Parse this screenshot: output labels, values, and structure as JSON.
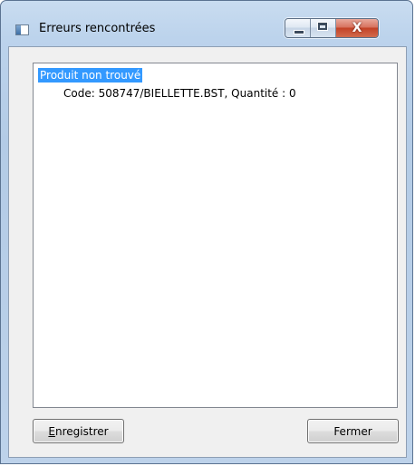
{
  "window": {
    "title": "Erreurs rencontrées",
    "icon": "app-window-icon",
    "caption_buttons": [
      "minimize-icon",
      "maximize-icon",
      "close-icon"
    ],
    "close_glyph": "X"
  },
  "errors_list": {
    "items": [
      {
        "text": "Produit non trouvé",
        "selected": true
      },
      {
        "text": "Code: 508747/BIELLETTE.BST, Quantité : 0",
        "selected": false
      }
    ]
  },
  "buttons": {
    "save": {
      "mnemonic": "E",
      "rest": "nregistrer"
    },
    "close": "Fermer"
  },
  "colors": {
    "selection": "#3399ff",
    "close_button": "#c34126"
  }
}
